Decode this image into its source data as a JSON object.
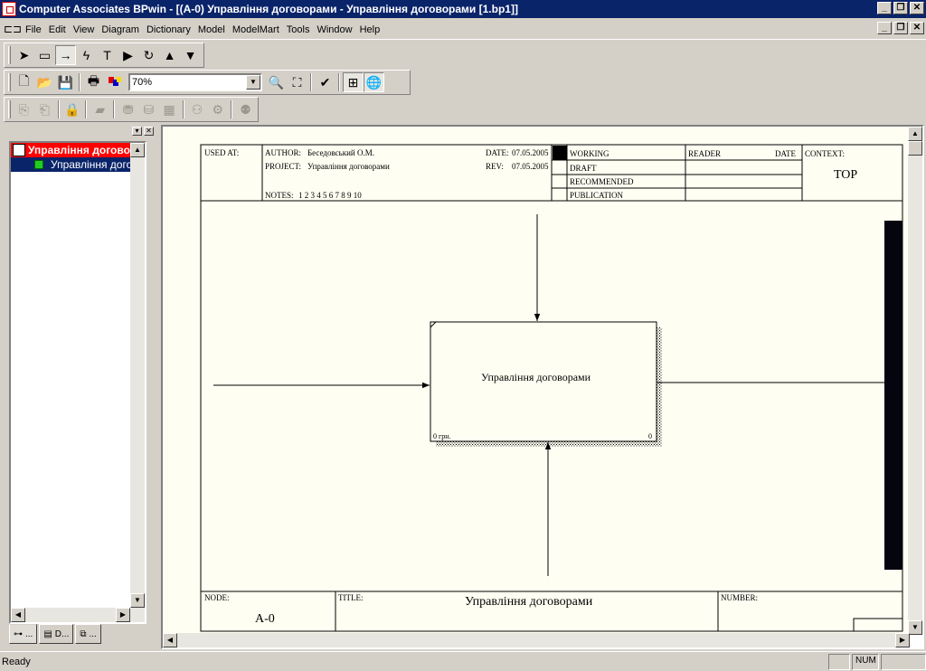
{
  "window": {
    "title": "Computer Associates BPwin - [(A-0) Управління договорами - Управління договорами  [1.bp1]]",
    "controls": {
      "minimize": "_",
      "restore": "❐",
      "close": "✕"
    }
  },
  "menu": [
    "File",
    "Edit",
    "View",
    "Diagram",
    "Dictionary",
    "Model",
    "ModelMart",
    "Tools",
    "Window",
    "Help"
  ],
  "toolbar": {
    "zoom_value": "70%"
  },
  "explorer": {
    "root_label": "Управління догово",
    "child_label": "Управління догов",
    "tabs": [
      "...",
      "D...",
      "..."
    ]
  },
  "diagram": {
    "header": {
      "used_at": "USED AT:",
      "author_label": "AUTHOR:",
      "author": "Беседовський О.М.",
      "project_label": "PROJECT:",
      "project": "Управління договорами",
      "date_label": "DATE:",
      "date": "07.05.2005",
      "rev_label": "REV:",
      "rev": "07.05.2005",
      "notes_label": "NOTES:",
      "notes": "1 2 3 4 5 6 7 8 9 10",
      "status": [
        "WORKING",
        "DRAFT",
        "RECOMMENDED",
        "PUBLICATION"
      ],
      "reader": "READER",
      "reader_date": "DATE",
      "context_label": "CONTEXT:",
      "context": "TOP"
    },
    "activity": {
      "name": "Управління договорами",
      "cost": "0 грн.",
      "number": "0"
    },
    "footer": {
      "node_label": "NODE:",
      "node": "A-0",
      "title_label": "TITLE:",
      "title": "Управління договорами",
      "number_label": "NUMBER:"
    }
  },
  "status": {
    "text": "Ready",
    "num": "NUM"
  }
}
